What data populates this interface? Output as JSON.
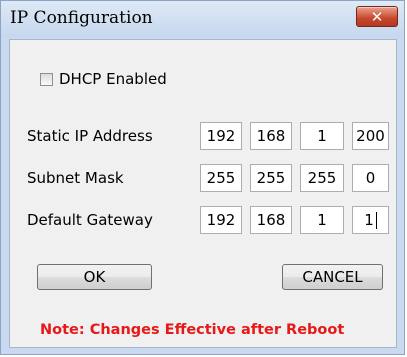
{
  "window": {
    "title": "IP Configuration",
    "close_icon": "close-icon",
    "close_glyph": "✕"
  },
  "dhcp": {
    "label": "DHCP Enabled",
    "checked": false
  },
  "fields": [
    {
      "label": "Static IP Address",
      "octets": [
        "192",
        "168",
        "1",
        "200"
      ]
    },
    {
      "label": "Subnet Mask",
      "octets": [
        "255",
        "255",
        "255",
        "0"
      ]
    },
    {
      "label": "Default Gateway",
      "octets": [
        "192",
        "168",
        "1",
        "1"
      ]
    }
  ],
  "buttons": {
    "ok": "OK",
    "cancel": "CANCEL"
  },
  "note": "Note: Changes Effective after Reboot",
  "colors": {
    "note": "#e81818",
    "close_button": "#c8472c"
  }
}
